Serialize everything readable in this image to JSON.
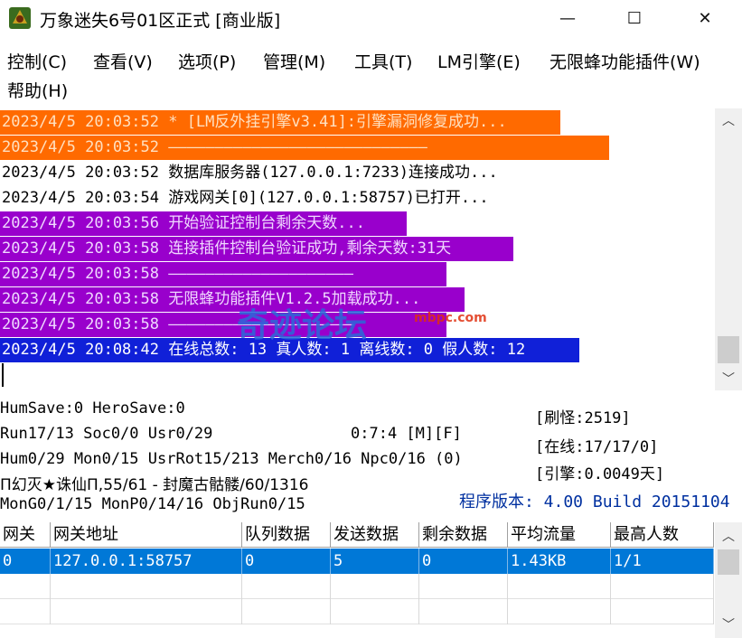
{
  "window": {
    "title": "万象迷失6号01区正式 [商业版]",
    "minimize": "—",
    "maximize": "☐",
    "close": "✕"
  },
  "menu": [
    {
      "label": "控制(C)"
    },
    {
      "label": "查看(V)"
    },
    {
      "label": "选项(P)"
    },
    {
      "label": "管理(M)"
    },
    {
      "label": "工具(T)"
    },
    {
      "label": "LM引擎(E)"
    },
    {
      "label": "无限蜂功能插件(W)"
    },
    {
      "label": "帮助(H)"
    }
  ],
  "log": [
    {
      "text": "2023/4/5 20:03:52 * [LM反外挂引擎v3.41]:引擎漏洞修复成功...",
      "style": "orange"
    },
    {
      "text": "2023/4/5 20:03:52 ————————————————————————————",
      "style": "orange"
    },
    {
      "text": "2023/4/5 20:03:52 数据库服务器(127.0.0.1:7233)连接成功...",
      "style": "plain"
    },
    {
      "text": "2023/4/5 20:03:54 游戏网关[0](127.0.0.1:58757)已打开...",
      "style": "plain"
    },
    {
      "text": "2023/4/5 20:03:56 开始验证控制台剩余天数...",
      "style": "purple"
    },
    {
      "text": "2023/4/5 20:03:58 连接插件控制台验证成功,剩余天数:31天",
      "style": "purple"
    },
    {
      "text": "2023/4/5 20:03:58 ————————————————————",
      "style": "purple"
    },
    {
      "text": "2023/4/5 20:03:58 无限蜂功能插件V1.2.5加载成功...",
      "style": "purple"
    },
    {
      "text": "2023/4/5 20:03:58 ————————————————————",
      "style": "purple"
    },
    {
      "text": "2023/4/5 20:08:42 在线总数: 13 真人数: 1 离线数: 0 假人数: 12",
      "style": "blue"
    }
  ],
  "status": {
    "line1": "HumSave:0 HeroSave:0",
    "line2": "Run17/13 Soc0/0 Usr0/29",
    "timer": "0:7:4 [M][F]",
    "line3": "Hum0/29 Mon0/15 UsrRot15/213 Merch0/16 Npc0/16 (0)",
    "line4": "Π幻灭★诛仙Π,55/61 - 封魔古骷髅/60/1316",
    "line5": "MonG0/1/15 MonP0/14/16 ObjRun0/15",
    "refresh": "[刷怪:2519]",
    "online": "[在线:17/17/0]",
    "engine": "[引擎:0.0049天]",
    "version": "程序版本: 4.00 Build 20151104"
  },
  "watermark": {
    "main": "奇迹论坛",
    "site": "mbpc.com"
  },
  "grid": {
    "columns": [
      "网关",
      "网关地址",
      "队列数据",
      "发送数据",
      "剩余数据",
      "平均流量",
      "最高人数"
    ],
    "rows": [
      [
        "0",
        "127.0.0.1:58757",
        "0",
        "5",
        "0",
        "1.43KB",
        "1/1"
      ]
    ]
  },
  "colors": {
    "orange": "#ff6a00",
    "purple": "#9900cc",
    "blue": "#1020d8",
    "selection": "#0078d7",
    "version_text": "#0030a0"
  }
}
